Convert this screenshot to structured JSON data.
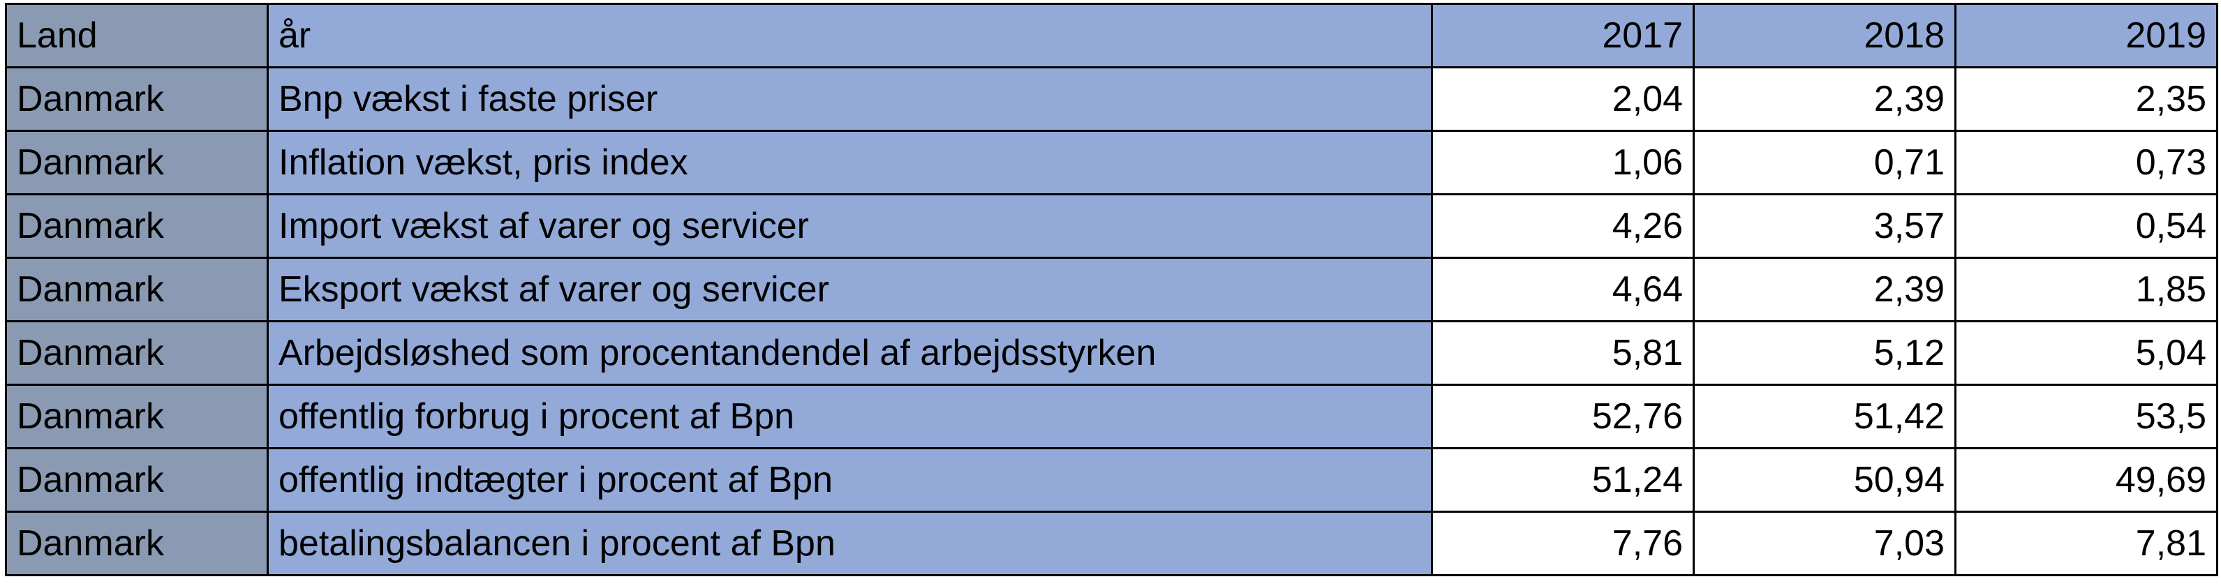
{
  "table": {
    "headers": [
      "Land",
      "år",
      "2017",
      "2018",
      "2019"
    ],
    "rows": [
      [
        "Danmark",
        "Bnp vækst i faste priser",
        "2,04",
        "2,39",
        "2,35"
      ],
      [
        "Danmark",
        "Inflation vækst, pris index",
        "1,06",
        "0,71",
        "0,73"
      ],
      [
        "Danmark",
        "Import vækst af varer og servicer",
        "4,26",
        "3,57",
        "0,54"
      ],
      [
        "Danmark",
        "Eksport vækst af varer og servicer",
        "4,64",
        "2,39",
        "1,85"
      ],
      [
        "Danmark",
        "Arbejdsløshed som procentandendel af arbejdsstyrken",
        "5,81",
        "5,12",
        "5,04"
      ],
      [
        "Danmark",
        "offentlig forbrug i procent af Bpn",
        "52,76",
        "51,42",
        "53,5"
      ],
      [
        "Danmark",
        "offentlig indtægter i procent af Bpn",
        "51,24",
        "50,94",
        "49,69"
      ],
      [
        "Danmark",
        "betalingsbalancen i procent af Bpn",
        "7,76",
        "7,03",
        "7,81"
      ]
    ]
  },
  "colors": {
    "land_column": "#8a9ab2",
    "header_and_label": "#93a9d8",
    "value_cells": "#ffffff"
  }
}
